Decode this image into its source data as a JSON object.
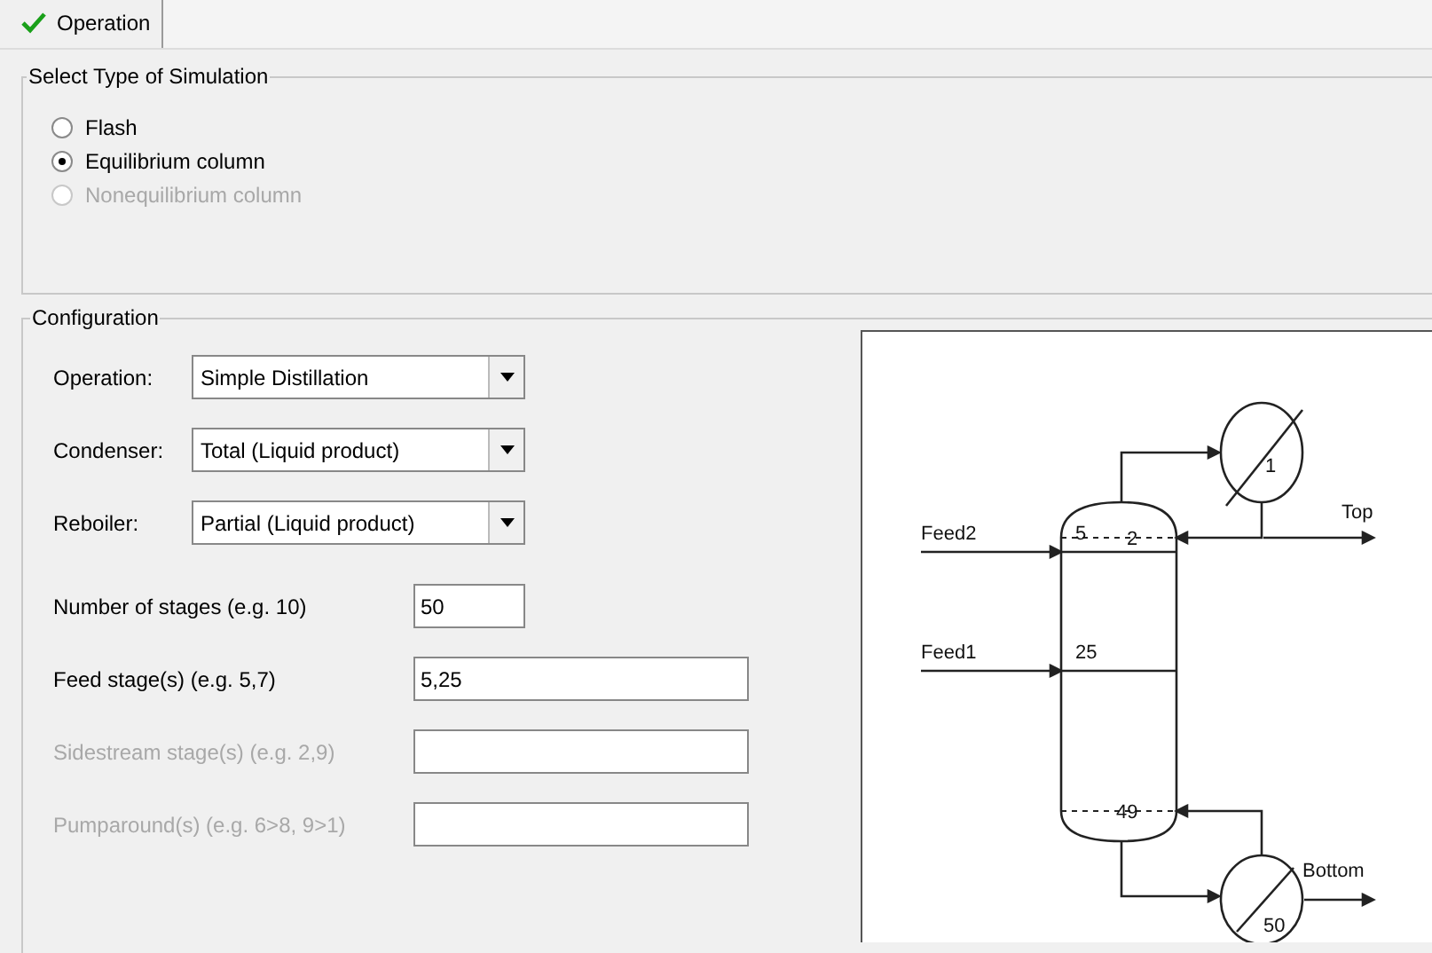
{
  "tab": {
    "label": "Operation",
    "selected": true,
    "checked": true
  },
  "simulation_type": {
    "title": "Select Type of Simulation",
    "options": [
      {
        "label": "Flash",
        "selected": false,
        "disabled": false
      },
      {
        "label": "Equilibrium column",
        "selected": true,
        "disabled": false
      },
      {
        "label": "Nonequilibrium column",
        "selected": false,
        "disabled": true
      }
    ]
  },
  "configuration": {
    "title": "Configuration",
    "dropdowns": [
      {
        "label": "Operation:",
        "value": "Simple Distillation"
      },
      {
        "label": "Condenser:",
        "value": "Total (Liquid product)"
      },
      {
        "label": "Reboiler:",
        "value": "Partial (Liquid product)"
      }
    ],
    "fields": [
      {
        "label": "Number of stages (e.g. 10)",
        "value": "50",
        "disabled": false,
        "kind": "short"
      },
      {
        "label": "Feed stage(s) (e.g. 5,7)",
        "value": "5,25",
        "disabled": false,
        "kind": "long"
      },
      {
        "label": "Sidestream stage(s) (e.g. 2,9)",
        "disabled": true,
        "kind": "long"
      },
      {
        "label": "Pumparound(s) (e.g. 6>8, 9>1)",
        "disabled": true,
        "kind": "long"
      }
    ]
  },
  "diagram": {
    "feeds": [
      {
        "label": "Feed2",
        "stage": "5"
      },
      {
        "label": "Feed1",
        "stage": "25"
      }
    ],
    "top_label": "Top",
    "bottom_label": "Bottom",
    "condenser_stage": "1",
    "top_tray": "2",
    "bottom_tray": "49",
    "reboiler_stage": "50"
  }
}
